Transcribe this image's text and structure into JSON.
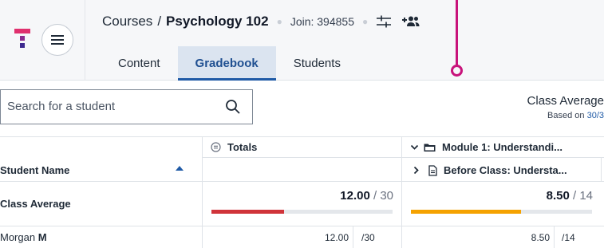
{
  "header": {
    "breadcrumb_parent": "Courses",
    "breadcrumb_separator": "/",
    "course_name": "Psychology 102",
    "join_code": "Join: 394855"
  },
  "tabs": [
    {
      "label": "Content",
      "active": false
    },
    {
      "label": "Gradebook",
      "active": true
    },
    {
      "label": "Students",
      "active": false
    }
  ],
  "search": {
    "placeholder": "Search for a student"
  },
  "class_average_panel": {
    "title": "Class Average",
    "subtitle_prefix": "Based on ",
    "subtitle_link": "30/3"
  },
  "grid": {
    "student_name_header": "Student Name",
    "totals_header": "Totals",
    "module_header": "Module 1: Understandi...",
    "activity_header": "Before Class: Understa...",
    "class_average_row": {
      "label": "Class Average",
      "totals_score": "12.00",
      "totals_max": " / 30",
      "totals_progress": 0.4,
      "module_score": "8.50",
      "module_max": " / 14",
      "module_progress": 0.61
    },
    "students": [
      {
        "first_name": "Morgan",
        "last_initial": "M",
        "totals_score": "12.00",
        "totals_max": "/30",
        "module_score": "8.50",
        "module_max": "/14"
      }
    ]
  },
  "colors": {
    "accent": "#1f5aa6",
    "totals_bar": "#d0343a",
    "module_bar": "#f5a200",
    "pointer": "#c8137b"
  }
}
